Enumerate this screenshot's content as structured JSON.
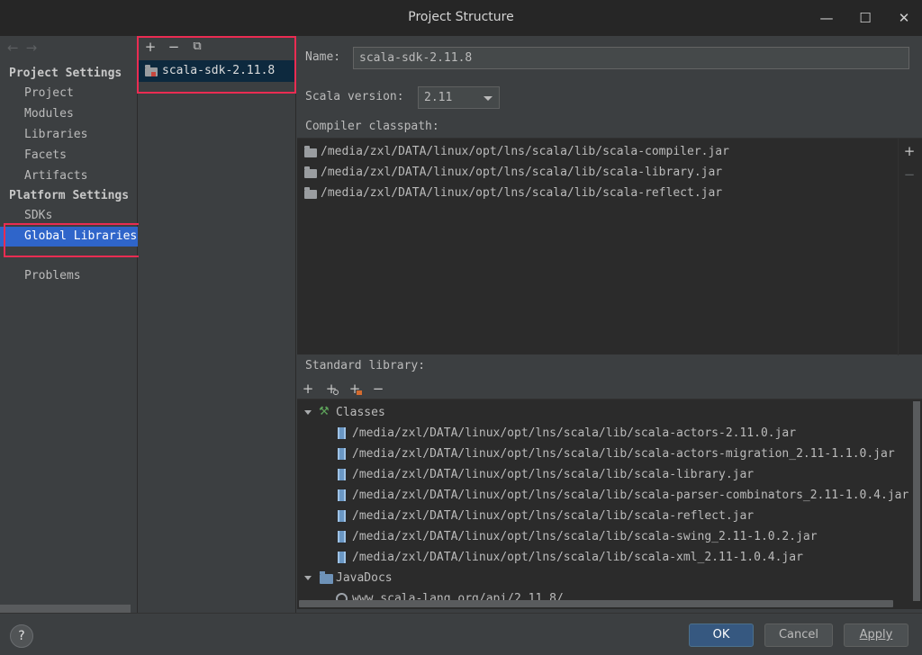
{
  "window": {
    "title": "Project Structure",
    "minimize_glyph": "—",
    "maximize_glyph": "☐",
    "close_glyph": "✕"
  },
  "nav": {
    "back_glyph": "←",
    "forward_glyph": "→",
    "project_settings_header": "Project Settings",
    "project_items": [
      "Project",
      "Modules",
      "Libraries",
      "Facets",
      "Artifacts"
    ],
    "platform_settings_header": "Platform Settings",
    "platform_items": [
      "SDKs",
      "Global Libraries"
    ],
    "selected": "Global Libraries",
    "problems": "Problems"
  },
  "library_list": {
    "toolbar": {
      "add_glyph": "+",
      "remove_glyph": "−",
      "copy_glyph": "⧉"
    },
    "items": [
      "scala-sdk-2.11.8"
    ]
  },
  "details": {
    "name_label": "Name:",
    "name_value": "scala-sdk-2.11.8",
    "scala_version_label": "Scala version:",
    "scala_version_value": "2.11",
    "compiler_classpath_label": "Compiler classpath:",
    "compiler_classpath": [
      "/media/zxl/DATA/linux/opt/lns/scala/lib/scala-compiler.jar",
      "/media/zxl/DATA/linux/opt/lns/scala/lib/scala-library.jar",
      "/media/zxl/DATA/linux/opt/lns/scala/lib/scala-reflect.jar"
    ],
    "classpath_add_glyph": "+",
    "classpath_remove_glyph": "−",
    "standard_library_label": "Standard library:",
    "std_toolbar": {
      "add_glyph": "+",
      "add_spec_glyph": "+",
      "add_jar_glyph": "+",
      "remove_glyph": "−"
    },
    "classes_label": "Classes",
    "classes": [
      "/media/zxl/DATA/linux/opt/lns/scala/lib/scala-actors-2.11.0.jar",
      "/media/zxl/DATA/linux/opt/lns/scala/lib/scala-actors-migration_2.11-1.1.0.jar",
      "/media/zxl/DATA/linux/opt/lns/scala/lib/scala-library.jar",
      "/media/zxl/DATA/linux/opt/lns/scala/lib/scala-parser-combinators_2.11-1.0.4.jar",
      "/media/zxl/DATA/linux/opt/lns/scala/lib/scala-reflect.jar",
      "/media/zxl/DATA/linux/opt/lns/scala/lib/scala-swing_2.11-1.0.2.jar",
      "/media/zxl/DATA/linux/opt/lns/scala/lib/scala-xml_2.11-1.0.4.jar"
    ],
    "javadocs_label": "JavaDocs",
    "javadocs": [
      "www.scala-lang.org/api/2.11.8/"
    ]
  },
  "buttons": {
    "help": "?",
    "ok": "OK",
    "cancel": "Cancel",
    "apply": "Apply"
  },
  "colors": {
    "selection": "#2f65ca",
    "highlight_box": "#ea2c52",
    "primary_button": "#365880"
  }
}
